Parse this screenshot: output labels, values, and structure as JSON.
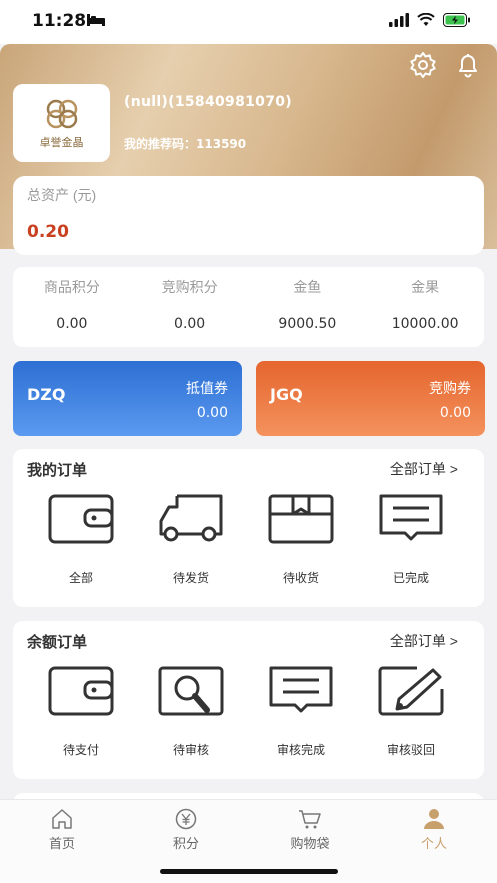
{
  "status_bar": {
    "time": "11:28"
  },
  "header": {
    "logo_text": "卓誉金晶",
    "user_name": "(null)(15840981070)",
    "referral_label": "我的推荐码：",
    "referral_code": "113590"
  },
  "assets": {
    "label": "总资产 (元)",
    "value": "0.20"
  },
  "points": [
    {
      "label": "商品积分",
      "value": "0.00"
    },
    {
      "label": "竞购积分",
      "value": "0.00"
    },
    {
      "label": "金鱼",
      "value": "9000.50"
    },
    {
      "label": "金果",
      "value": "10000.00"
    }
  ],
  "vouchers": [
    {
      "code": "DZQ",
      "name": "抵值券",
      "value": "0.00",
      "color": "#3d7fe0"
    },
    {
      "code": "JGQ",
      "name": "竞购券",
      "value": "0.00",
      "color": "#ec7a40"
    }
  ],
  "my_orders": {
    "title": "我的订单",
    "all_label": "全部订单 >",
    "items": [
      {
        "label": "全部",
        "icon": "wallet-icon"
      },
      {
        "label": "待发货",
        "icon": "truck-icon"
      },
      {
        "label": "待收货",
        "icon": "box-icon"
      },
      {
        "label": "已完成",
        "icon": "message-icon"
      }
    ]
  },
  "balance_orders": {
    "title": "余额订单",
    "all_label": "全部订单 >",
    "items": [
      {
        "label": "待支付",
        "icon": "wallet-icon"
      },
      {
        "label": "待审核",
        "icon": "search-icon"
      },
      {
        "label": "审核完成",
        "icon": "message-icon"
      },
      {
        "label": "审核驳回",
        "icon": "edit-icon"
      }
    ]
  },
  "tabs": [
    {
      "label": "首页",
      "icon": "home-icon"
    },
    {
      "label": "积分",
      "icon": "yen-icon"
    },
    {
      "label": "购物袋",
      "icon": "cart-icon"
    },
    {
      "label": "个人",
      "icon": "person-icon",
      "active": true
    }
  ],
  "colors": {
    "accent_gold": "#c8a06c",
    "asset_red": "#c8401f"
  }
}
